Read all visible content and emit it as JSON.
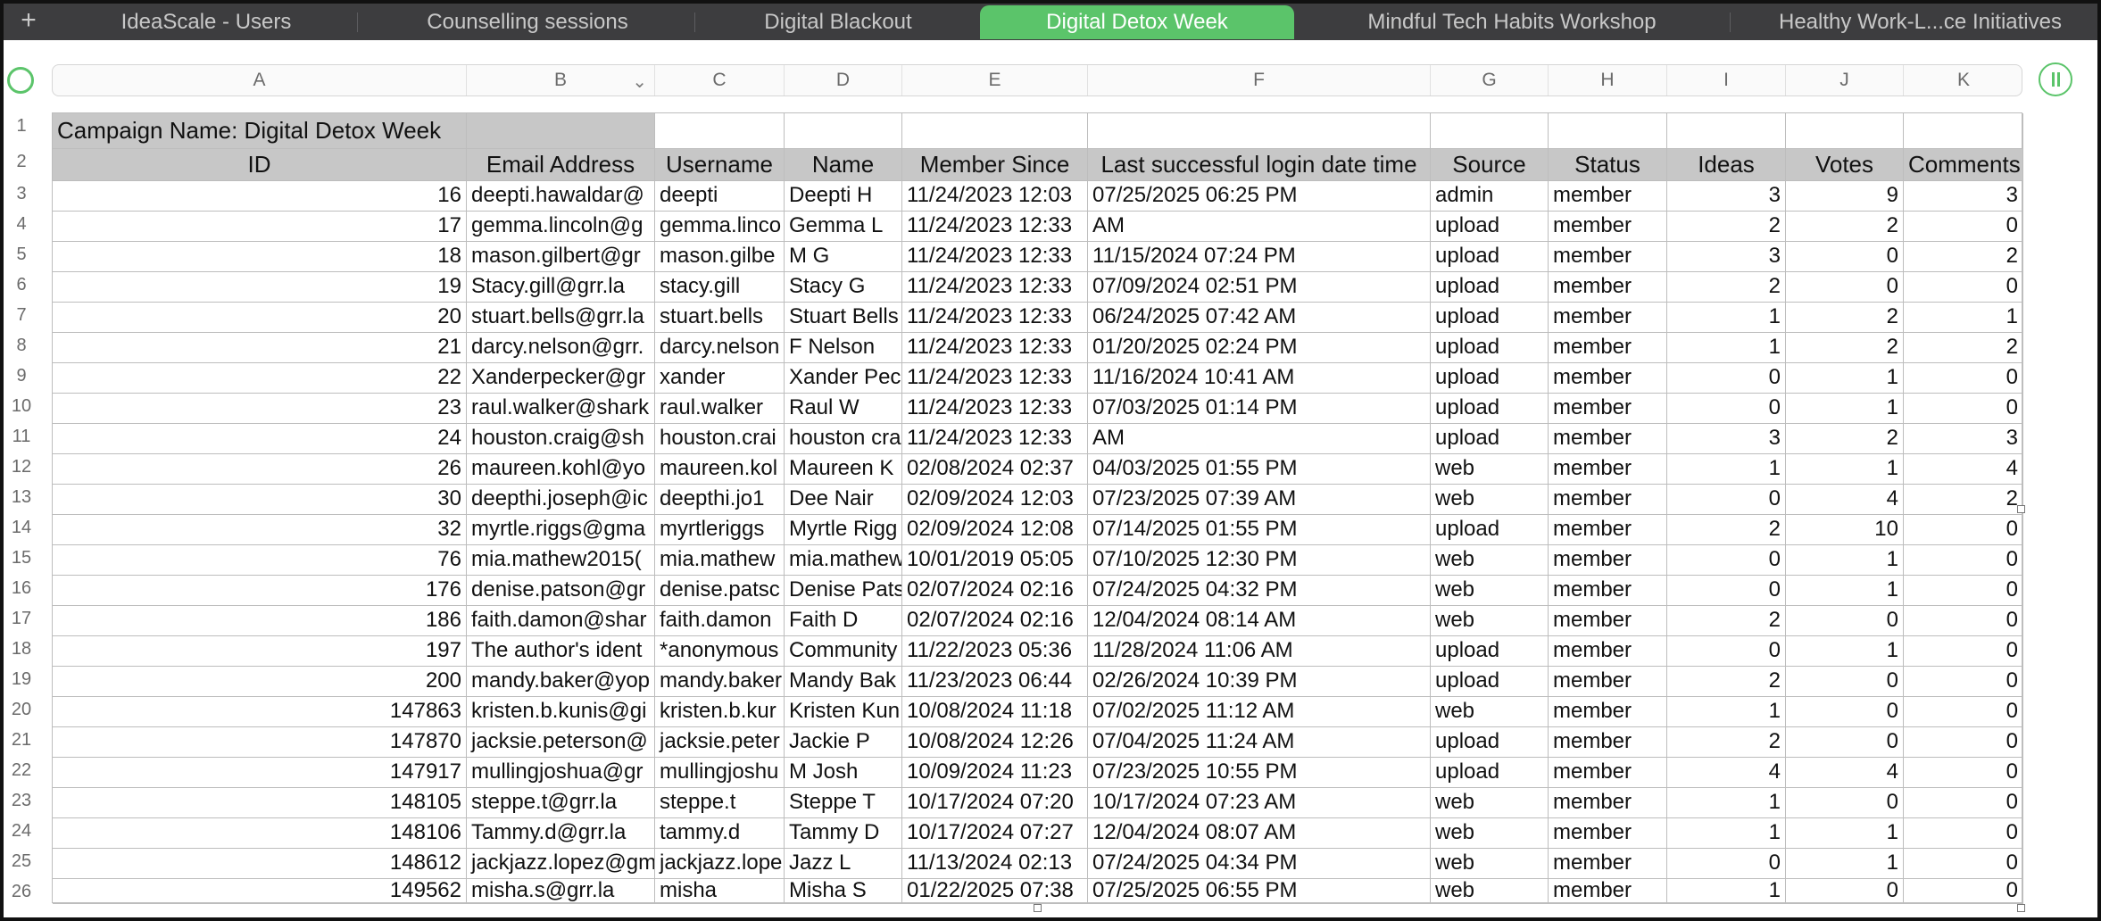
{
  "tabs": {
    "add_label": "+",
    "items": [
      {
        "label": "IdeaScale - Users",
        "active": false
      },
      {
        "label": "Counselling sessions",
        "active": false
      },
      {
        "label": "Digital Blackout",
        "active": false
      },
      {
        "label": "Digital Detox Week",
        "active": true
      },
      {
        "label": "Mindful Tech Habits Workshop",
        "active": false
      },
      {
        "label": "Healthy Work-L...ce Initiatives",
        "active": false
      }
    ]
  },
  "columns": [
    "A",
    "B",
    "C",
    "D",
    "E",
    "F",
    "G",
    "H",
    "I",
    "J",
    "K"
  ],
  "row_numbers": [
    "1",
    "2",
    "3",
    "4",
    "5",
    "6",
    "7",
    "8",
    "9",
    "10",
    "11",
    "12",
    "13",
    "14",
    "15",
    "16",
    "17",
    "18",
    "19",
    "20",
    "21",
    "22",
    "23",
    "24",
    "25",
    "26"
  ],
  "sheet": {
    "campaign_title": "Campaign Name: Digital Detox Week",
    "headers": [
      "ID",
      "Email Address",
      "Username",
      "Name",
      "Member Since",
      "Last successful login date time",
      "Source",
      "Status",
      "Ideas",
      "Votes",
      "Comments"
    ],
    "rows": [
      [
        "16",
        "deepti.hawaldar@",
        "deepti",
        "Deepti H",
        "11/24/2023 12:03",
        "07/25/2025 06:25 PM",
        "admin",
        "member",
        "3",
        "9",
        "3"
      ],
      [
        "17",
        "gemma.lincoln@g",
        "gemma.linco",
        "Gemma L",
        "11/24/2023 12:33",
        "AM",
        "upload",
        "member",
        "2",
        "2",
        "0"
      ],
      [
        "18",
        "mason.gilbert@gr",
        "mason.gilbe",
        "M G",
        "11/24/2023 12:33",
        "11/15/2024 07:24 PM",
        "upload",
        "member",
        "3",
        "0",
        "2"
      ],
      [
        "19",
        "Stacy.gill@grr.la",
        "stacy.gill",
        "Stacy G",
        "11/24/2023 12:33",
        "07/09/2024 02:51 PM",
        "upload",
        "member",
        "2",
        "0",
        "0"
      ],
      [
        "20",
        "stuart.bells@grr.la",
        "stuart.bells",
        "Stuart Bells",
        "11/24/2023 12:33",
        "06/24/2025 07:42 AM",
        "upload",
        "member",
        "1",
        "2",
        "1"
      ],
      [
        "21",
        "darcy.nelson@grr.",
        "darcy.nelson",
        "F Nelson",
        "11/24/2023 12:33",
        "01/20/2025 02:24 PM",
        "upload",
        "member",
        "1",
        "2",
        "2"
      ],
      [
        "22",
        "Xanderpecker@gr",
        "xander",
        "Xander Pec",
        "11/24/2023 12:33",
        "11/16/2024 10:41 AM",
        "upload",
        "member",
        "0",
        "1",
        "0"
      ],
      [
        "23",
        "raul.walker@shark",
        "raul.walker",
        "Raul W",
        "11/24/2023 12:33",
        "07/03/2025 01:14 PM",
        "upload",
        "member",
        "0",
        "1",
        "0"
      ],
      [
        "24",
        "houston.craig@sh",
        "houston.crai",
        "houston cra",
        "11/24/2023 12:33",
        "AM",
        "upload",
        "member",
        "3",
        "2",
        "3"
      ],
      [
        "26",
        "maureen.kohl@yo",
        "maureen.kol",
        "Maureen K",
        "02/08/2024 02:37",
        "04/03/2025 01:55 PM",
        "web",
        "member",
        "1",
        "1",
        "4"
      ],
      [
        "30",
        "deepthi.joseph@ic",
        "deepthi.jo1",
        "Dee Nair",
        "02/09/2024 12:03",
        "07/23/2025 07:39 AM",
        "web",
        "member",
        "0",
        "4",
        "2"
      ],
      [
        "32",
        "myrtle.riggs@gma",
        "myrtleriggs",
        "Myrtle Rigg",
        "02/09/2024 12:08",
        "07/14/2025 01:55 PM",
        "upload",
        "member",
        "2",
        "10",
        "0"
      ],
      [
        "76",
        "mia.mathew2015(",
        "mia.mathew",
        "mia.mathew",
        "10/01/2019 05:05",
        "07/10/2025 12:30 PM",
        "web",
        "member",
        "0",
        "1",
        "0"
      ],
      [
        "176",
        "denise.patson@gr",
        "denise.patsc",
        "Denise Pats",
        "02/07/2024 02:16",
        "07/24/2025 04:32 PM",
        "web",
        "member",
        "0",
        "1",
        "0"
      ],
      [
        "186",
        "faith.damon@shar",
        "faith.damon",
        "Faith D",
        "02/07/2024 02:16",
        "12/04/2024 08:14 AM",
        "web",
        "member",
        "2",
        "0",
        "0"
      ],
      [
        "197",
        "The author's ident",
        "*anonymous",
        "Community",
        "11/22/2023 05:36",
        "11/28/2024 11:06 AM",
        "upload",
        "member",
        "0",
        "1",
        "0"
      ],
      [
        "200",
        "mandy.baker@yop",
        "mandy.baker",
        "Mandy Bak",
        "11/23/2023 06:44",
        "02/26/2024 10:39 PM",
        "upload",
        "member",
        "2",
        "0",
        "0"
      ],
      [
        "147863",
        "kristen.b.kunis@gi",
        "kristen.b.kur",
        "Kristen Kun",
        "10/08/2024 11:18",
        "07/02/2025 11:12 AM",
        "web",
        "member",
        "1",
        "0",
        "0"
      ],
      [
        "147870",
        "jacksie.peterson@",
        "jacksie.peter",
        "Jackie P",
        "10/08/2024 12:26",
        "07/04/2025 11:24 AM",
        "upload",
        "member",
        "2",
        "0",
        "0"
      ],
      [
        "147917",
        "mullingjoshua@gr",
        "mullingjoshu",
        "M Josh",
        "10/09/2024 11:23",
        "07/23/2025 10:55 PM",
        "upload",
        "member",
        "4",
        "4",
        "0"
      ],
      [
        "148105",
        "steppe.t@grr.la",
        "steppe.t",
        "Steppe T",
        "10/17/2024 07:20",
        "10/17/2024 07:23 AM",
        "web",
        "member",
        "1",
        "0",
        "0"
      ],
      [
        "148106",
        "Tammy.d@grr.la",
        "tammy.d",
        "Tammy D",
        "10/17/2024 07:27",
        "12/04/2024 08:07 AM",
        "web",
        "member",
        "1",
        "1",
        "0"
      ],
      [
        "148612",
        "jackjazz.lopez@gm",
        "jackjazz.lope",
        "Jazz L",
        "11/13/2024 02:13",
        "07/24/2025 04:34 PM",
        "web",
        "member",
        "0",
        "1",
        "0"
      ],
      [
        "149562",
        "misha.s@grr.la",
        "misha",
        "Misha S",
        "01/22/2025 07:38",
        "07/25/2025 06:55 PM",
        "web",
        "member",
        "1",
        "0",
        "0"
      ]
    ]
  }
}
